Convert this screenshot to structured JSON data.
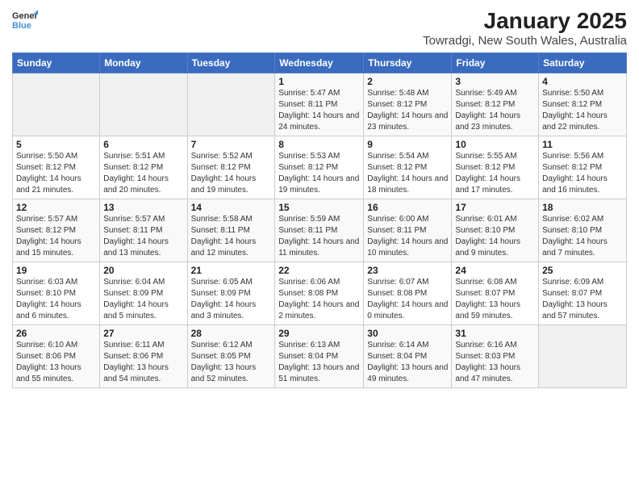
{
  "header": {
    "logo_line1": "General",
    "logo_line2": "Blue",
    "title": "January 2025",
    "subtitle": "Towradgi, New South Wales, Australia"
  },
  "weekdays": [
    "Sunday",
    "Monday",
    "Tuesday",
    "Wednesday",
    "Thursday",
    "Friday",
    "Saturday"
  ],
  "weeks": [
    [
      {
        "day": "",
        "info": ""
      },
      {
        "day": "",
        "info": ""
      },
      {
        "day": "",
        "info": ""
      },
      {
        "day": "1",
        "info": "Sunrise: 5:47 AM\nSunset: 8:11 PM\nDaylight: 14 hours and 24 minutes."
      },
      {
        "day": "2",
        "info": "Sunrise: 5:48 AM\nSunset: 8:12 PM\nDaylight: 14 hours and 23 minutes."
      },
      {
        "day": "3",
        "info": "Sunrise: 5:49 AM\nSunset: 8:12 PM\nDaylight: 14 hours and 23 minutes."
      },
      {
        "day": "4",
        "info": "Sunrise: 5:50 AM\nSunset: 8:12 PM\nDaylight: 14 hours and 22 minutes."
      }
    ],
    [
      {
        "day": "5",
        "info": "Sunrise: 5:50 AM\nSunset: 8:12 PM\nDaylight: 14 hours and 21 minutes."
      },
      {
        "day": "6",
        "info": "Sunrise: 5:51 AM\nSunset: 8:12 PM\nDaylight: 14 hours and 20 minutes."
      },
      {
        "day": "7",
        "info": "Sunrise: 5:52 AM\nSunset: 8:12 PM\nDaylight: 14 hours and 19 minutes."
      },
      {
        "day": "8",
        "info": "Sunrise: 5:53 AM\nSunset: 8:12 PM\nDaylight: 14 hours and 19 minutes."
      },
      {
        "day": "9",
        "info": "Sunrise: 5:54 AM\nSunset: 8:12 PM\nDaylight: 14 hours and 18 minutes."
      },
      {
        "day": "10",
        "info": "Sunrise: 5:55 AM\nSunset: 8:12 PM\nDaylight: 14 hours and 17 minutes."
      },
      {
        "day": "11",
        "info": "Sunrise: 5:56 AM\nSunset: 8:12 PM\nDaylight: 14 hours and 16 minutes."
      }
    ],
    [
      {
        "day": "12",
        "info": "Sunrise: 5:57 AM\nSunset: 8:12 PM\nDaylight: 14 hours and 15 minutes."
      },
      {
        "day": "13",
        "info": "Sunrise: 5:57 AM\nSunset: 8:11 PM\nDaylight: 14 hours and 13 minutes."
      },
      {
        "day": "14",
        "info": "Sunrise: 5:58 AM\nSunset: 8:11 PM\nDaylight: 14 hours and 12 minutes."
      },
      {
        "day": "15",
        "info": "Sunrise: 5:59 AM\nSunset: 8:11 PM\nDaylight: 14 hours and 11 minutes."
      },
      {
        "day": "16",
        "info": "Sunrise: 6:00 AM\nSunset: 8:11 PM\nDaylight: 14 hours and 10 minutes."
      },
      {
        "day": "17",
        "info": "Sunrise: 6:01 AM\nSunset: 8:10 PM\nDaylight: 14 hours and 9 minutes."
      },
      {
        "day": "18",
        "info": "Sunrise: 6:02 AM\nSunset: 8:10 PM\nDaylight: 14 hours and 7 minutes."
      }
    ],
    [
      {
        "day": "19",
        "info": "Sunrise: 6:03 AM\nSunset: 8:10 PM\nDaylight: 14 hours and 6 minutes."
      },
      {
        "day": "20",
        "info": "Sunrise: 6:04 AM\nSunset: 8:09 PM\nDaylight: 14 hours and 5 minutes."
      },
      {
        "day": "21",
        "info": "Sunrise: 6:05 AM\nSunset: 8:09 PM\nDaylight: 14 hours and 3 minutes."
      },
      {
        "day": "22",
        "info": "Sunrise: 6:06 AM\nSunset: 8:08 PM\nDaylight: 14 hours and 2 minutes."
      },
      {
        "day": "23",
        "info": "Sunrise: 6:07 AM\nSunset: 8:08 PM\nDaylight: 14 hours and 0 minutes."
      },
      {
        "day": "24",
        "info": "Sunrise: 6:08 AM\nSunset: 8:07 PM\nDaylight: 13 hours and 59 minutes."
      },
      {
        "day": "25",
        "info": "Sunrise: 6:09 AM\nSunset: 8:07 PM\nDaylight: 13 hours and 57 minutes."
      }
    ],
    [
      {
        "day": "26",
        "info": "Sunrise: 6:10 AM\nSunset: 8:06 PM\nDaylight: 13 hours and 55 minutes."
      },
      {
        "day": "27",
        "info": "Sunrise: 6:11 AM\nSunset: 8:06 PM\nDaylight: 13 hours and 54 minutes."
      },
      {
        "day": "28",
        "info": "Sunrise: 6:12 AM\nSunset: 8:05 PM\nDaylight: 13 hours and 52 minutes."
      },
      {
        "day": "29",
        "info": "Sunrise: 6:13 AM\nSunset: 8:04 PM\nDaylight: 13 hours and 51 minutes."
      },
      {
        "day": "30",
        "info": "Sunrise: 6:14 AM\nSunset: 8:04 PM\nDaylight: 13 hours and 49 minutes."
      },
      {
        "day": "31",
        "info": "Sunrise: 6:16 AM\nSunset: 8:03 PM\nDaylight: 13 hours and 47 minutes."
      },
      {
        "day": "",
        "info": ""
      }
    ]
  ]
}
